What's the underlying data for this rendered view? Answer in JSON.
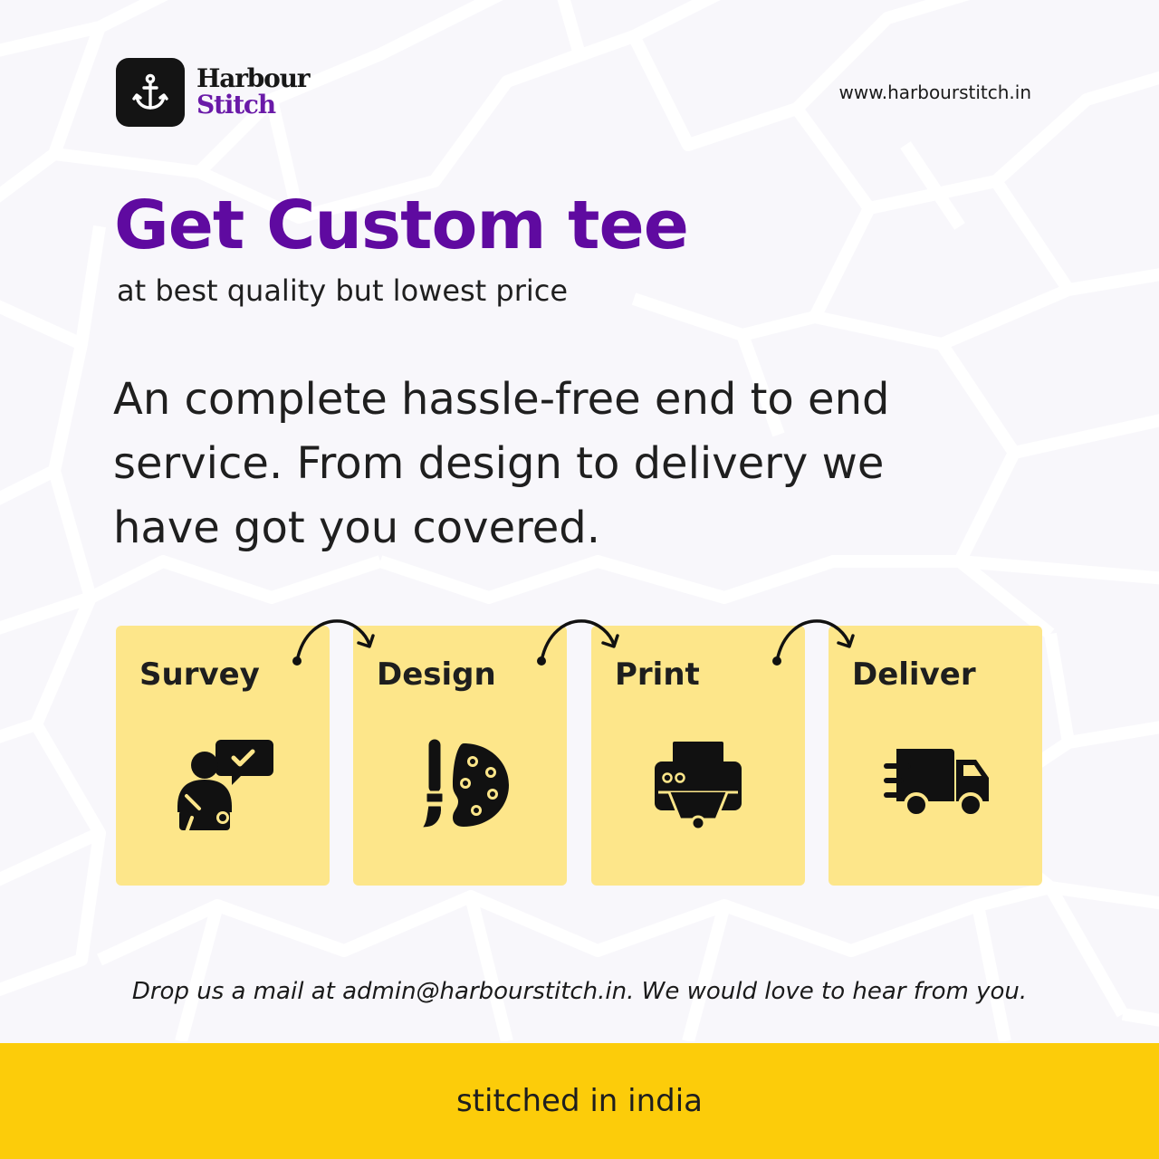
{
  "brand": {
    "line1": "Harbour",
    "line2": "Stitch",
    "website": "www.harbourstitch.in",
    "icon": "anchor-icon"
  },
  "hero": {
    "headline": "Get Custom tee",
    "subheadline": "at best quality but lowest price",
    "body": "An complete hassle-free end to end service. From design to delivery we have got you covered."
  },
  "steps": [
    {
      "label": "Survey",
      "icon": "survey-person-chat-icon"
    },
    {
      "label": "Design",
      "icon": "paint-palette-brush-icon"
    },
    {
      "label": "Print",
      "icon": "printer-icon"
    },
    {
      "label": "Deliver",
      "icon": "delivery-truck-icon"
    }
  ],
  "contact": {
    "message": "Drop us a mail at admin@harbourstitch.in. We would love to hear from you."
  },
  "footer": {
    "tagline": "stitched in india"
  },
  "colors": {
    "headline": "#5f0aa0",
    "brand_accent": "#6a1aa8",
    "card": "#fde68a",
    "footer_bar": "#fccc0a",
    "background": "#f8f7fb"
  }
}
